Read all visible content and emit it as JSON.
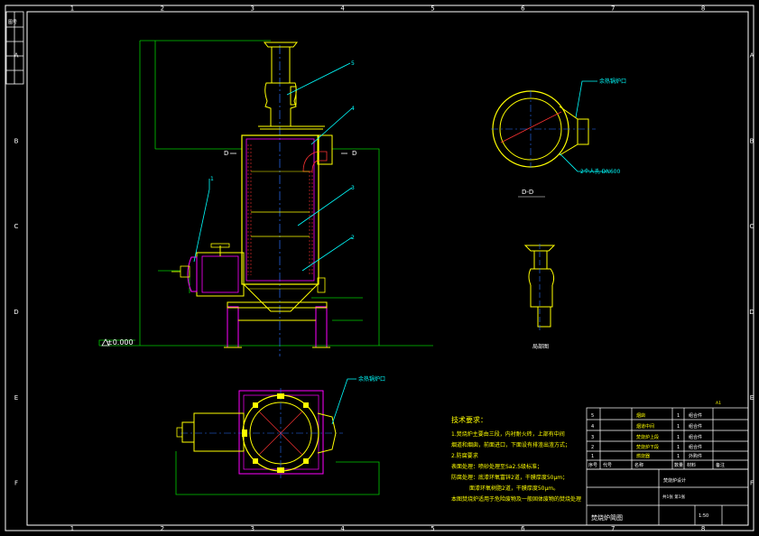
{
  "drawing": {
    "title": "焚烧炉简图",
    "colors": {
      "background": "#000000",
      "frame": "#ffffff",
      "outline": "#ffff00",
      "refractory": "#ff00ff",
      "leader": "#00ffff",
      "extension": "#00cc00",
      "centerline": "#2a6fff",
      "hatch": "#ff3333"
    },
    "grid_columns": [
      "1",
      "2",
      "3",
      "4",
      "5",
      "6",
      "7",
      "8"
    ],
    "grid_rows": [
      "A",
      "B",
      "C",
      "D",
      "E",
      "F"
    ],
    "elevation": "±0.000",
    "section_marks": [
      "D",
      "D"
    ],
    "balloons": [
      "1",
      "2",
      "3",
      "4",
      "5"
    ],
    "views": {
      "section_label": "D-D",
      "side_view_label": "局部图",
      "section_callouts": [
        "余热锅炉口",
        "2个人孔 DN600"
      ],
      "plan_callout": "余热锅炉口"
    },
    "technical_requirements": {
      "heading": "技术要求：",
      "items": [
        "1.焚烧炉主要由三段，内衬耐火砖，上部有中间",
        "烟道和烟囱，前面进口，下面设有排渣出渣方式；",
        "2.防腐要求",
        "表面处理：喷砂处理至Sa2.5级标准；",
        "防腐处理：底漆环氧富锌2道，干膜厚度50μm；",
        "面漆环氧树脂2道，干膜厚度50μm。",
        "本图焚烧炉适用于危险废物及一般固体废物的焚烧处理"
      ]
    },
    "parts_list": {
      "rows": [
        {
          "no": "5",
          "name": "烟囱",
          "qty": "1",
          "material": "组合件"
        },
        {
          "no": "4",
          "name": "烟道中间",
          "qty": "1",
          "material": "组合件"
        },
        {
          "no": "3",
          "name": "焚烧炉上段",
          "qty": "1",
          "material": "组合件"
        },
        {
          "no": "2",
          "name": "焚烧炉下段",
          "qty": "1",
          "material": "组合件"
        },
        {
          "no": "1",
          "name": "燃烧器",
          "qty": "1",
          "material": "外购件"
        }
      ],
      "header": {
        "no": "序号",
        "code": "代号",
        "name": "名称",
        "qty": "数量",
        "material": "材料",
        "note": "备注"
      }
    },
    "title_block": {
      "drawing_name": "焚烧炉简图",
      "company": "焚烧炉设计",
      "scale": "1:50",
      "sheet": "共1张 第1张",
      "mark": "A1"
    },
    "stamp_top_left": "图号"
  }
}
